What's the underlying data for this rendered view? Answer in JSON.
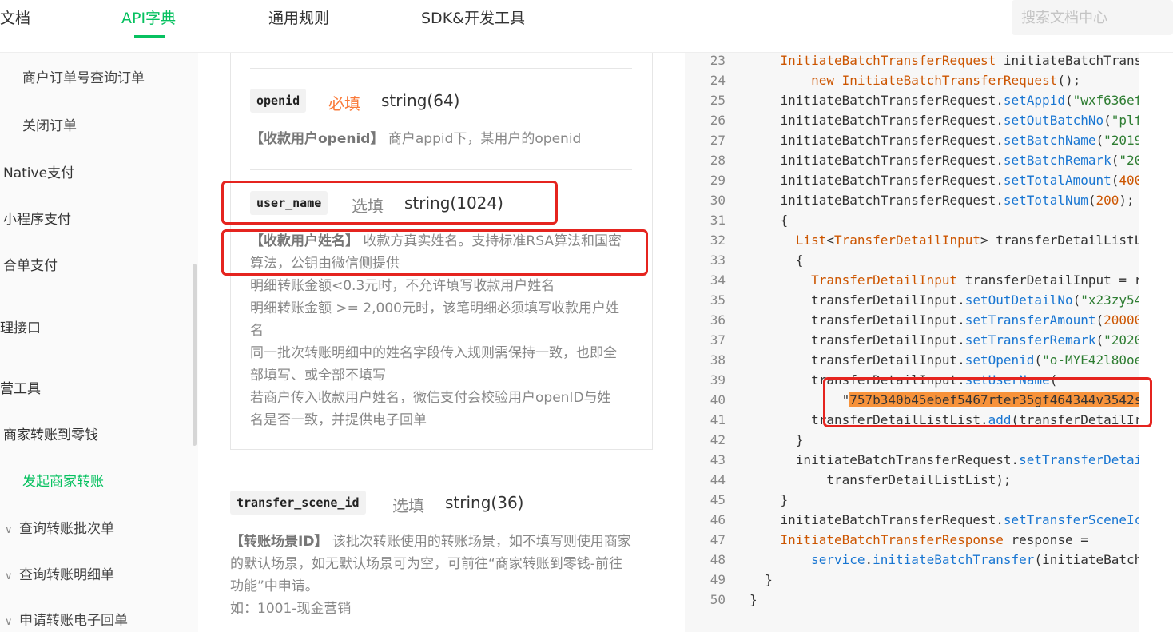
{
  "nav": {
    "items": [
      "文档",
      "API字典",
      "通用规则",
      "SDK&开发工具"
    ],
    "active": "API字典",
    "search_placeholder": "搜索文档中心"
  },
  "sidebar": {
    "items": [
      {
        "label": "商户订单号查询订单"
      },
      {
        "label": "关闭订单"
      },
      {
        "label": "Native支付"
      },
      {
        "label": "小程序支付"
      },
      {
        "label": "合单支付"
      },
      {
        "label": "理接口"
      },
      {
        "label": "营工具"
      },
      {
        "label": "商家转账到零钱"
      },
      {
        "label": "发起商家转账"
      },
      {
        "label": "查询转账批次单"
      },
      {
        "label": "查询转账明细单"
      },
      {
        "label": "申请转账电子回单"
      }
    ]
  },
  "params": [
    {
      "name": "openid",
      "required": "必填",
      "type": "string(64)",
      "desc_title": "【收款用户openid】",
      "desc": "商户appid下，某用户的openid"
    },
    {
      "name": "user_name",
      "required": "选填",
      "type": "string(1024)",
      "desc_title": "【收款用户姓名】",
      "desc": [
        "收款方真实姓名。支持标准RSA算法和国密",
        "算法，公钥由微信侧提供",
        "明细转账金额<0.3元时，不允许填写收款用户姓名",
        "明细转账金额 >= 2,000元时，该笔明细必须填写收款用户姓",
        "名",
        "同一批次转账明细中的姓名字段传入规则需保持一致，也即全",
        "部填写、或全部不填写",
        "若商户传入收款用户姓名，微信支付会校验用户openID与姓",
        "名是否一致，并提供电子回单"
      ]
    },
    {
      "name": "transfer_scene_id",
      "required": "选填",
      "type": "string(36)",
      "desc_title": "【转账场景ID】",
      "desc": [
        "该批次转账使用的转账场景，如不填写则使用商家",
        "的默认场景，如无默认场景可为空，可前往“商家转账到零钱-前往",
        "功能”中申请。",
        "如：1001-现金营销"
      ]
    }
  ],
  "code": {
    "lines": [
      {
        "n": "23",
        "t": "    InitiateBatchTransferRequest initiateBatchTrans"
      },
      {
        "n": "24",
        "t": "        new InitiateBatchTransferRequest();"
      },
      {
        "n": "25",
        "t": "    initiateBatchTransferRequest.setAppid(\"wxf636ef"
      },
      {
        "n": "26",
        "t": "    initiateBatchTransferRequest.setOutBatchNo(\"plf"
      },
      {
        "n": "27",
        "t": "    initiateBatchTransferRequest.setBatchName(\"2019"
      },
      {
        "n": "28",
        "t": "    initiateBatchTransferRequest.setBatchRemark(\"20"
      },
      {
        "n": "29",
        "t": "    initiateBatchTransferRequest.setTotalAmount(400"
      },
      {
        "n": "30",
        "t": "    initiateBatchTransferRequest.setTotalNum(200);"
      },
      {
        "n": "31",
        "t": "    {"
      },
      {
        "n": "32",
        "t": "      List<TransferDetailInput> transferDetailListL"
      },
      {
        "n": "33",
        "t": "      {"
      },
      {
        "n": "34",
        "t": "        TransferDetailInput transferDetailInput = r"
      },
      {
        "n": "35",
        "t": "        transferDetailInput.setOutDetailNo(\"x23zy54"
      },
      {
        "n": "36",
        "t": "        transferDetailInput.setTransferAmount(20000"
      },
      {
        "n": "37",
        "t": "        transferDetailInput.setTransferRemark(\"2020"
      },
      {
        "n": "38",
        "t": "        transferDetailInput.setOpenid(\"o-MYE42l80oe"
      },
      {
        "n": "39",
        "t": "        transferDetailInput.setUserName("
      },
      {
        "n": "40",
        "t": "            \"757b340b45ebef5467rter35gf464344v3542s"
      },
      {
        "n": "41",
        "t": "        transferDetailListList.add(transferDetailIr"
      },
      {
        "n": "42",
        "t": "      }"
      },
      {
        "n": "43",
        "t": "      initiateBatchTransferRequest.setTransferDetai"
      },
      {
        "n": "44",
        "t": "          transferDetailListList);"
      },
      {
        "n": "45",
        "t": "    }"
      },
      {
        "n": "46",
        "t": "    initiateBatchTransferRequest.setTransferSceneIc"
      },
      {
        "n": "47",
        "t": "    InitiateBatchTransferResponse response ="
      },
      {
        "n": "48",
        "t": "        service.initiateBatchTransfer(initiateBatch"
      },
      {
        "n": "49",
        "t": "  }"
      },
      {
        "n": "50",
        "t": "}"
      }
    ]
  },
  "colors": {
    "accent": "#07c160",
    "required": "#fa7a39",
    "annotation": "#e5241f",
    "highlight": "#f7923a"
  }
}
